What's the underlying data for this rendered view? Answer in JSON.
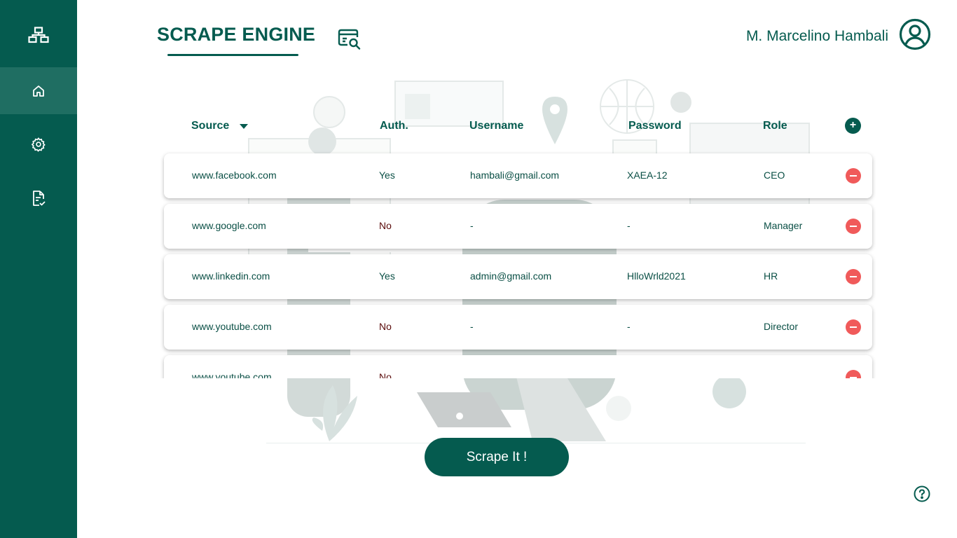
{
  "app": {
    "brand": "SCRAPE ENGINE",
    "user_name": "M. Marcelino Hambali"
  },
  "sidebar": {
    "items": [
      {
        "name": "home",
        "icon": "home-icon",
        "active": true
      },
      {
        "name": "settings",
        "icon": "gear-icon",
        "active": false
      },
      {
        "name": "reports",
        "icon": "document-check-icon",
        "active": false
      }
    ]
  },
  "table": {
    "headers": {
      "source": "Source",
      "auth": "Auth.",
      "username": "Username",
      "password": "Password",
      "role": "Role"
    },
    "add_label": "+",
    "rows": [
      {
        "source": "www.facebook.com",
        "auth": "Yes",
        "username": "hambali@gmail.com",
        "password": "XAEA-12",
        "role": "CEO"
      },
      {
        "source": "www.google.com",
        "auth": "No",
        "username": "-",
        "password": "-",
        "role": "Manager"
      },
      {
        "source": "www.linkedin.com",
        "auth": "Yes",
        "username": "admin@gmail.com",
        "password": "HlloWrld2021",
        "role": "HR"
      },
      {
        "source": "www.youtube.com",
        "auth": "No",
        "username": "-",
        "password": "-",
        "role": "Director"
      },
      {
        "source": "www.youtube.com",
        "auth": "No",
        "username": "",
        "password": "",
        "role": ""
      }
    ]
  },
  "actions": {
    "scrape_label": "Scrape It !"
  },
  "colors": {
    "primary": "#055b4f",
    "sidebar_active": "#1f6e62",
    "danger": "#f05a5a"
  }
}
